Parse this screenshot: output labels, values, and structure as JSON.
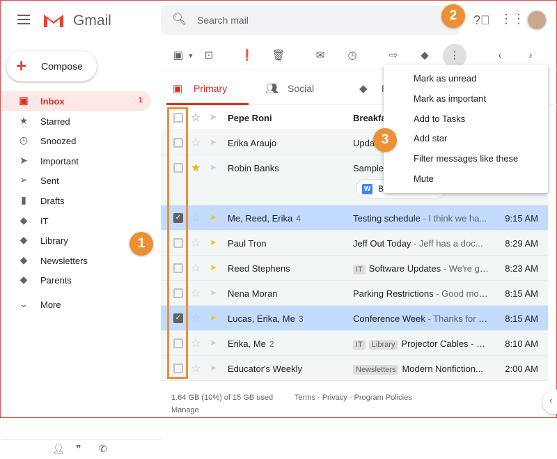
{
  "header": {
    "app_name": "Gmail",
    "search_placeholder": "Search mail"
  },
  "sidebar": {
    "compose": "Compose",
    "items": [
      {
        "label": "Inbox",
        "count": "1",
        "icon": "inbox-icon",
        "glyph": "▣"
      },
      {
        "label": "Starred",
        "icon": "star-icon",
        "glyph": "★"
      },
      {
        "label": "Snoozed",
        "icon": "clock-icon",
        "glyph": "◷"
      },
      {
        "label": "Important",
        "icon": "important-icon",
        "glyph": "➤"
      },
      {
        "label": "Sent",
        "icon": "send-icon",
        "glyph": "➢"
      },
      {
        "label": "Drafts",
        "icon": "draft-icon",
        "glyph": "▮"
      },
      {
        "label": "IT",
        "icon": "label-icon",
        "glyph": "◆"
      },
      {
        "label": "Library",
        "icon": "label-icon",
        "glyph": "◆"
      },
      {
        "label": "Newsletters",
        "icon": "label-icon",
        "glyph": "◆"
      },
      {
        "label": "Parents",
        "icon": "label-icon",
        "glyph": "◆"
      },
      {
        "label": "More",
        "icon": "chevron-down-icon",
        "glyph": "⌄"
      }
    ]
  },
  "tabs": [
    {
      "label": "Primary"
    },
    {
      "label": "Social"
    },
    {
      "label": "P"
    }
  ],
  "menu": [
    "Mark as unread",
    "Mark as important",
    "Add to Tasks",
    "Add star",
    "Filter messages like these",
    "Mute"
  ],
  "callouts": [
    "1",
    "2",
    "3"
  ],
  "emails": [
    {
      "sender": "Pepe Roni",
      "count": "",
      "labels": [],
      "subject": "Breakfa",
      "snippet": "",
      "time": "",
      "unread": true,
      "selected": false,
      "starred": false,
      "important": false
    },
    {
      "sender": "Erika Araujo",
      "count": "",
      "labels": [],
      "subject": "Upda",
      "snippet": "",
      "time": "",
      "unread": false,
      "selected": false,
      "starred": false,
      "important": false
    },
    {
      "sender": "Robin Banks",
      "count": "",
      "labels": [],
      "subject": "Sample",
      "snippet": "",
      "time": "",
      "unread": false,
      "selected": false,
      "starred": true,
      "important": false,
      "attachment": "B"
    },
    {
      "sender": "Me, Reed, Erika",
      "count": "4",
      "labels": [],
      "subject": "Testing schedule",
      "snippet": " - I think we ha...",
      "time": "9:15 AM",
      "unread": false,
      "selected": true,
      "starred": false,
      "important": true
    },
    {
      "sender": "Paul Tron",
      "count": "",
      "labels": [],
      "subject": "Jeff Out Today ",
      "snippet": " - Jeff has a doc...",
      "time": "8:29 AM",
      "unread": false,
      "selected": false,
      "starred": false,
      "important": true
    },
    {
      "sender": "Reed Stephens",
      "count": "",
      "labels": [
        "IT"
      ],
      "subject": "Software Updates",
      "snippet": " - We're go...",
      "time": "8:23 AM",
      "unread": false,
      "selected": false,
      "starred": false,
      "important": true
    },
    {
      "sender": "Nena Moran",
      "count": "",
      "labels": [],
      "subject": "Parking Restrictions",
      "snippet": " - Good mor...",
      "time": "8:15 AM",
      "unread": false,
      "selected": false,
      "starred": false,
      "important": false
    },
    {
      "sender": "Lucas, Erika, Me",
      "count": "3",
      "labels": [],
      "subject": "Conference Week",
      "snippet": " - Thanks for le...",
      "time": "8:15 AM",
      "unread": false,
      "selected": true,
      "starred": false,
      "important": true
    },
    {
      "sender": "Erika, Me",
      "count": "2",
      "labels": [
        "IT",
        "Library"
      ],
      "subject": "Projector Cables",
      "snippet": " - M...",
      "time": "8:10 AM",
      "unread": false,
      "selected": false,
      "starred": false,
      "important": false
    },
    {
      "sender": "Educator's Weekly",
      "count": "",
      "labels": [
        "Newsletters"
      ],
      "subject": "Modern Nonfiction...",
      "snippet": "",
      "time": "2:00 AM",
      "unread": false,
      "selected": false,
      "starred": false,
      "important": false
    }
  ],
  "footer": {
    "storage": "1.64 GB (10%) of 15 GB used",
    "manage": "Manage",
    "links": "Terms · Privacy · Program Policies"
  },
  "colors": {
    "accent": "#d93025",
    "callout": "#ed8f33",
    "selected_row": "#c2dbff"
  }
}
